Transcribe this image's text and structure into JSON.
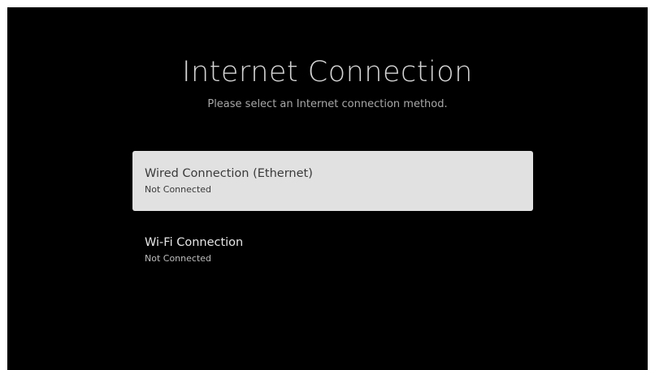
{
  "screen": {
    "title": "Internet Connection",
    "subtitle": "Please select an Internet connection method."
  },
  "options": [
    {
      "label": "Wired Connection (Ethernet)",
      "status": "Not Connected",
      "focused": true
    },
    {
      "label": "Wi-Fi Connection",
      "status": "Not Connected",
      "focused": false
    }
  ],
  "colors": {
    "background": "#000000",
    "focused_item": "#e1e1e1",
    "title_text": "#d4d4d4"
  }
}
